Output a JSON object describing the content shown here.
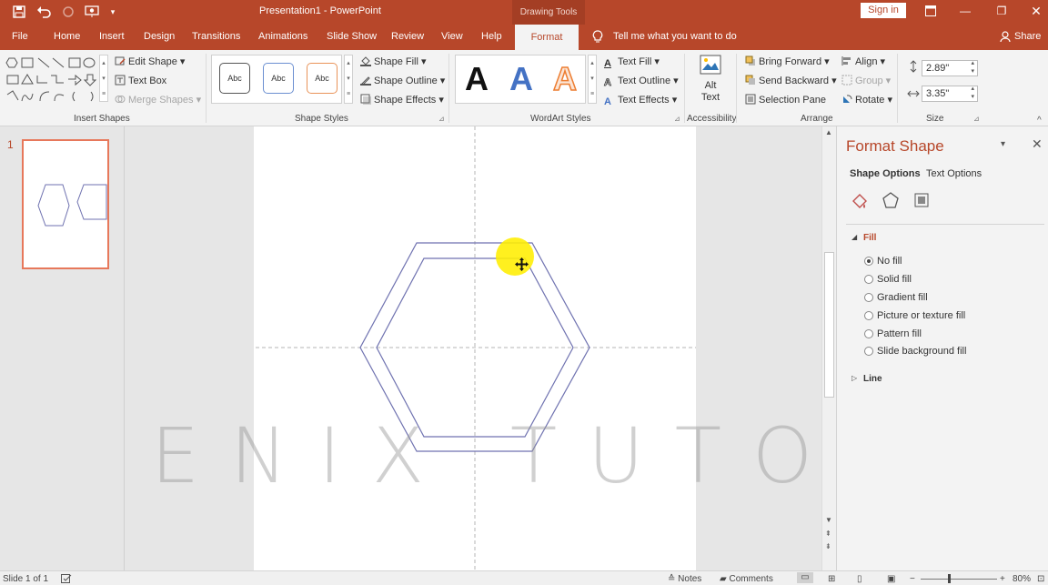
{
  "window": {
    "title": "Presentation1  -  PowerPoint",
    "context_tab_group": "Drawing Tools",
    "sign_in": "Sign in"
  },
  "menu": {
    "tabs": [
      "File",
      "Home",
      "Insert",
      "Design",
      "Transitions",
      "Animations",
      "Slide Show",
      "Review",
      "View",
      "Help"
    ],
    "active_tab": "Format",
    "tell_me": "Tell me what you want to do",
    "share": "Share"
  },
  "ribbon": {
    "insert_shapes": {
      "label": "Insert Shapes",
      "edit_shape": "Edit Shape",
      "text_box": "Text Box",
      "merge_shapes": "Merge Shapes"
    },
    "shape_styles": {
      "label": "Shape Styles",
      "presets": [
        "Abc",
        "Abc",
        "Abc"
      ],
      "shape_fill": "Shape Fill",
      "shape_outline": "Shape Outline",
      "shape_effects": "Shape Effects"
    },
    "wordart": {
      "label": "WordArt Styles",
      "presets": [
        "A",
        "A",
        "A"
      ],
      "text_fill": "Text Fill",
      "text_outline": "Text Outline",
      "text_effects": "Text Effects"
    },
    "accessibility": {
      "label": "Accessibility",
      "alt_text_line1": "Alt",
      "alt_text_line2": "Text"
    },
    "arrange": {
      "label": "Arrange",
      "bring_forward": "Bring Forward",
      "send_backward": "Send Backward",
      "selection_pane": "Selection Pane",
      "align": "Align",
      "group": "Group",
      "rotate": "Rotate"
    },
    "size": {
      "label": "Size",
      "height": "2.89\"",
      "width": "3.35\""
    }
  },
  "thumbnails": {
    "slide_number": "1"
  },
  "watermark": "ENIX TUTORIAL",
  "format_pane": {
    "title": "Format Shape",
    "tabs": [
      "Shape Options",
      "Text Options"
    ],
    "fill_section": "Fill",
    "fill_options": [
      "No fill",
      "Solid fill",
      "Gradient fill",
      "Picture or texture fill",
      "Pattern fill",
      "Slide background fill"
    ],
    "selected_fill": "No fill",
    "line_section": "Line"
  },
  "statusbar": {
    "slide_info": "Slide 1 of 1",
    "notes": "Notes",
    "comments": "Comments",
    "zoom": "80%"
  },
  "colors": {
    "accent": "#b7472a",
    "hexagon_stroke": "#6f72b0",
    "cursor_highlight": "#ffee00"
  }
}
